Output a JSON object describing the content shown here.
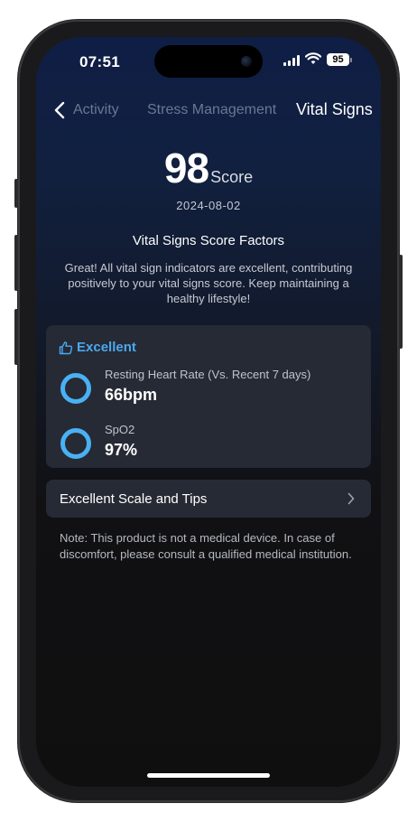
{
  "status_bar": {
    "time": "07:51",
    "battery": "95"
  },
  "tabs": {
    "items": [
      {
        "label": "Activity",
        "active": false
      },
      {
        "label": "Stress Management",
        "active": false
      },
      {
        "label": "Vital Signs",
        "active": true
      }
    ]
  },
  "score": {
    "value": "98",
    "label": "Score",
    "date": "2024-08-02"
  },
  "factors": {
    "title": "Vital Signs Score Factors",
    "description": "Great! All vital sign indicators are excellent, contributing positively to your vital signs score. Keep maintaining a healthy lifestyle!"
  },
  "card": {
    "rating": "Excellent",
    "accent_color": "#4aa8f0",
    "metrics": [
      {
        "label": "Resting Heart Rate (Vs. Recent 7 days)",
        "value": "66bpm"
      },
      {
        "label": "SpO2",
        "value": "97%"
      }
    ]
  },
  "tips": {
    "label": "Excellent Scale and Tips"
  },
  "note": "Note: This product is not a medical device. In case of discomfort, please consult a qualified medical institution."
}
